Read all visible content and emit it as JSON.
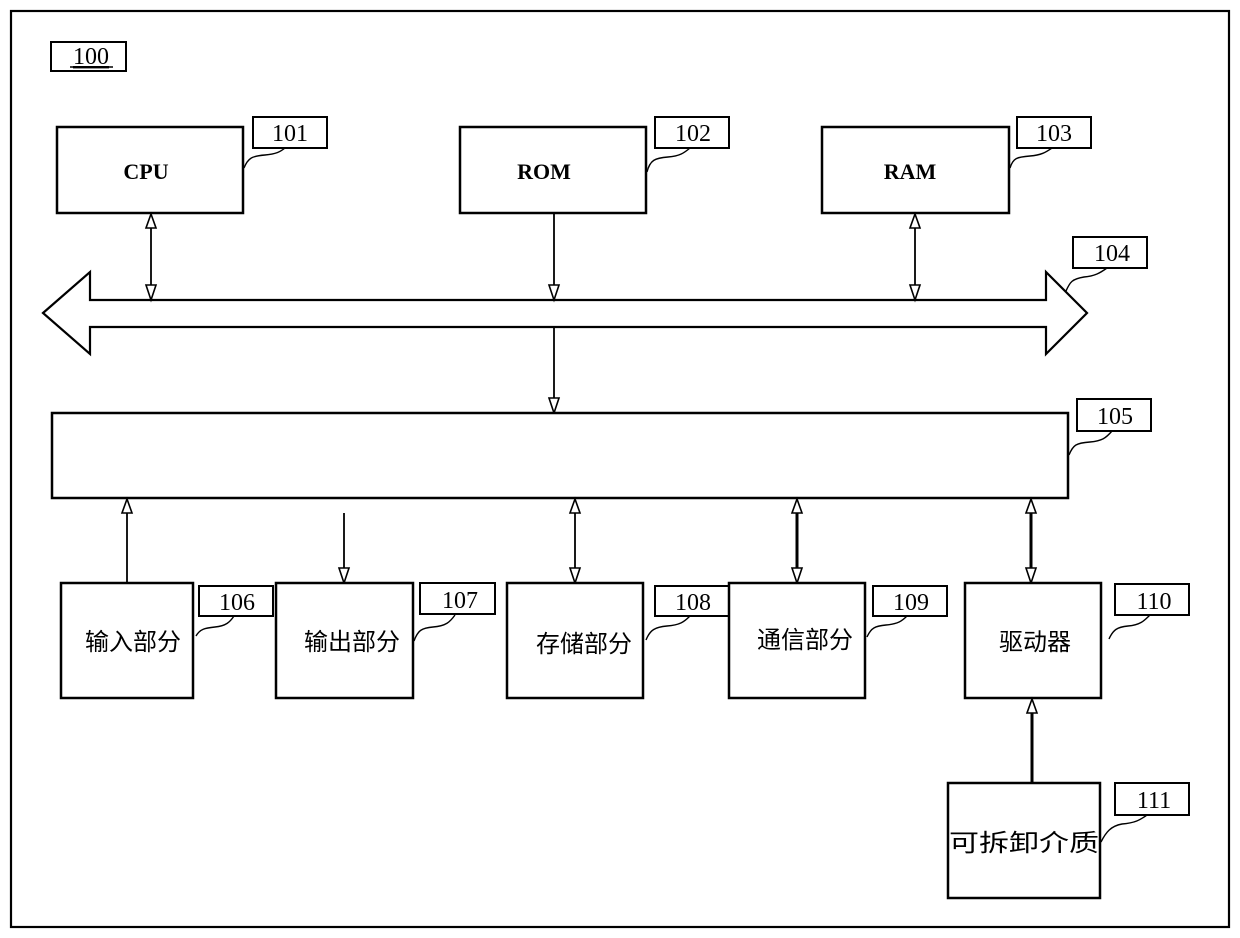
{
  "figure": {
    "ref": "100",
    "components": {
      "cpu": {
        "ref": "101",
        "label": "CPU"
      },
      "rom": {
        "ref": "102",
        "label": "ROM"
      },
      "ram": {
        "ref": "103",
        "label": "RAM"
      },
      "bus": {
        "ref": "104",
        "label": ""
      },
      "io_interface": {
        "ref": "105",
        "label": ""
      },
      "input_part": {
        "ref": "106",
        "label": "输入部分"
      },
      "output_part": {
        "ref": "107",
        "label": "输出部分"
      },
      "storage_part": {
        "ref": "108",
        "label": "存储部分"
      },
      "communication_part": {
        "ref": "109",
        "label": "通信部分"
      },
      "driver": {
        "ref": "110",
        "label": "驱动器"
      },
      "removable_medium": {
        "ref": "111",
        "label": "可拆卸介质"
      }
    },
    "connections": [
      {
        "from": "cpu",
        "to": "bus",
        "direction": "bidirectional"
      },
      {
        "from": "rom",
        "to": "bus",
        "direction": "one-way"
      },
      {
        "from": "ram",
        "to": "bus",
        "direction": "bidirectional"
      },
      {
        "from": "bus",
        "to": "io_interface",
        "direction": "one-way"
      },
      {
        "from": "input_part",
        "to": "io_interface",
        "direction": "one-way"
      },
      {
        "from": "io_interface",
        "to": "output_part",
        "direction": "one-way"
      },
      {
        "from": "storage_part",
        "to": "io_interface",
        "direction": "bidirectional"
      },
      {
        "from": "communication_part",
        "to": "io_interface",
        "direction": "bidirectional"
      },
      {
        "from": "driver",
        "to": "io_interface",
        "direction": "bidirectional"
      },
      {
        "from": "removable_medium",
        "to": "driver",
        "direction": "one-way"
      }
    ],
    "colors": {
      "stroke": "#000000",
      "background": "#ffffff"
    }
  }
}
